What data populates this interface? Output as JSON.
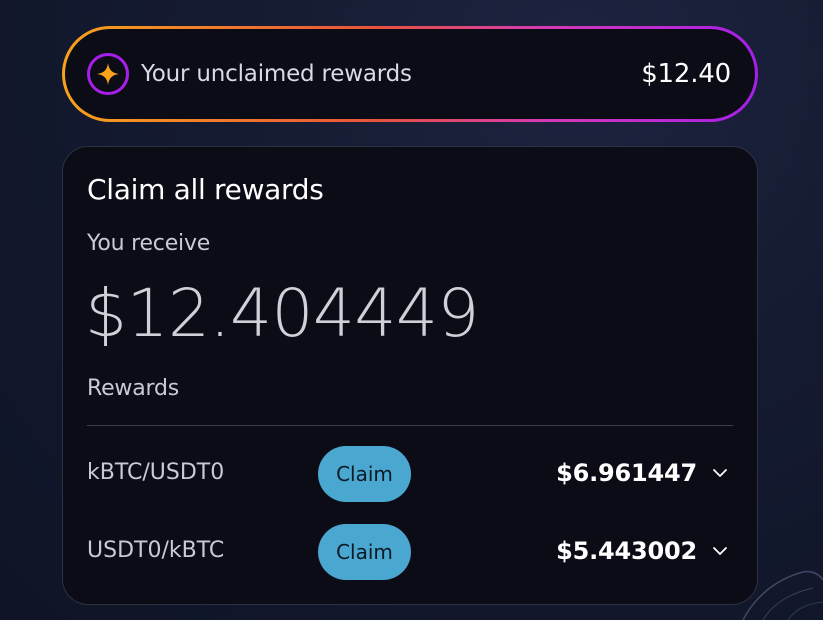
{
  "banner": {
    "label": "Your unclaimed rewards",
    "amount": "$12.40",
    "icon": "sparkle-star-icon"
  },
  "card": {
    "title": "Claim all rewards",
    "receive_label": "You receive",
    "receive_amount": "$12.404449",
    "rewards_label": "Rewards",
    "rows": [
      {
        "pair": "kBTC/USDT0",
        "button_label": "Claim",
        "amount": "$6.961447"
      },
      {
        "pair": "USDT0/kBTC",
        "button_label": "Claim",
        "amount": "$5.443002"
      }
    ]
  },
  "colors": {
    "accent_orange": "#f7a21b",
    "accent_purple": "#a51fe8",
    "claim_button": "#4aa7cf",
    "card_bg": "#0b0c16"
  }
}
